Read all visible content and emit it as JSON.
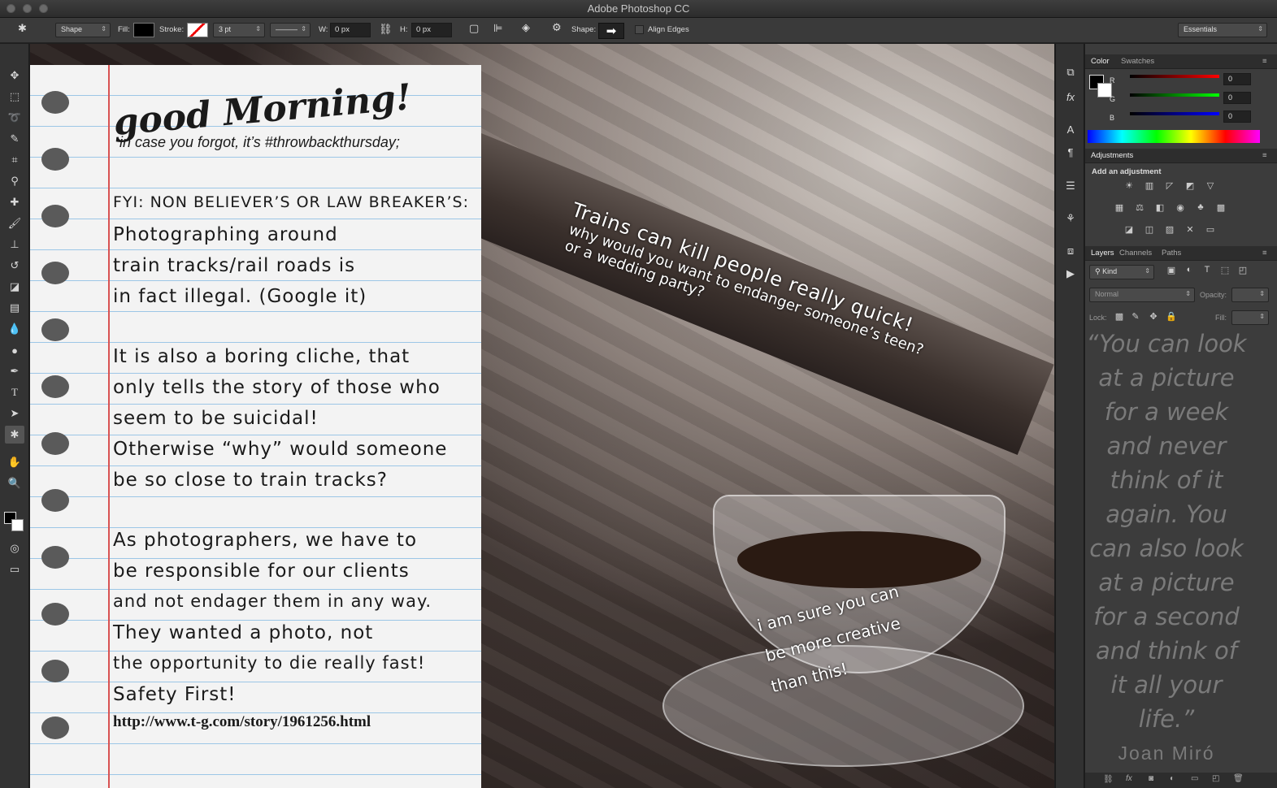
{
  "window": {
    "title": "Adobe Photoshop CC"
  },
  "options": {
    "mode": "Shape",
    "fill_label": "Fill:",
    "stroke_label": "Stroke:",
    "stroke_size": "3 pt",
    "w_label": "W:",
    "w_value": "0 px",
    "h_label": "H:",
    "h_value": "0 px",
    "shape_label": "Shape:",
    "align_edges": "Align Edges",
    "workspace": "Essentials"
  },
  "panels": {
    "color_tab": "Color",
    "swatches_tab": "Swatches",
    "r_label": "R",
    "g_label": "G",
    "b_label": "B",
    "r_value": "0",
    "g_value": "0",
    "b_value": "0",
    "adjustments_tab": "Adjustments",
    "add_adjustment": "Add an adjustment",
    "layers_tab": "Layers",
    "channels_tab": "Channels",
    "paths_tab": "Paths",
    "kind": "Kind",
    "blend_mode": "Normal",
    "opacity_label": "Opacity:",
    "lock_label": "Lock:",
    "fill_label": "Fill:",
    "quote": "“You can look at a picture for a week and never think of it again. You can also look at a picture for a second and think of it all your life.”",
    "quote_author": "Joan Miró"
  },
  "canvas": {
    "headline": "good Morning!",
    "subhead": "in case you forgot, it’s #throwbackthursday;",
    "fyi": "FYI: NON BELIEVER’S OR LAW BREAKER’S:",
    "p1": [
      "Photographing around",
      "train tracks/rail roads is",
      "in fact illegal. (Google it)"
    ],
    "p2": [
      "It is also a boring cliche, that",
      "only tells the story of those who",
      "seem to be suicidal!",
      "Otherwise “why” would someone",
      "be so close to train tracks?"
    ],
    "p3": [
      "As photographers, we have to",
      "be responsible for our clients",
      "and not endager them in any way.",
      "They wanted a photo, not",
      "the opportunity to die really fast!",
      "Safety First!"
    ],
    "url": "http://www.t-g.com/story/1961256.html",
    "rail_title": "Trains can kill people really quick!",
    "rail_line2": "why would you want to endanger someone’s teen?",
    "rail_line3": "or a wedding party?",
    "cup_text": [
      "i am sure you can",
      "be more creative",
      "than this!"
    ]
  }
}
